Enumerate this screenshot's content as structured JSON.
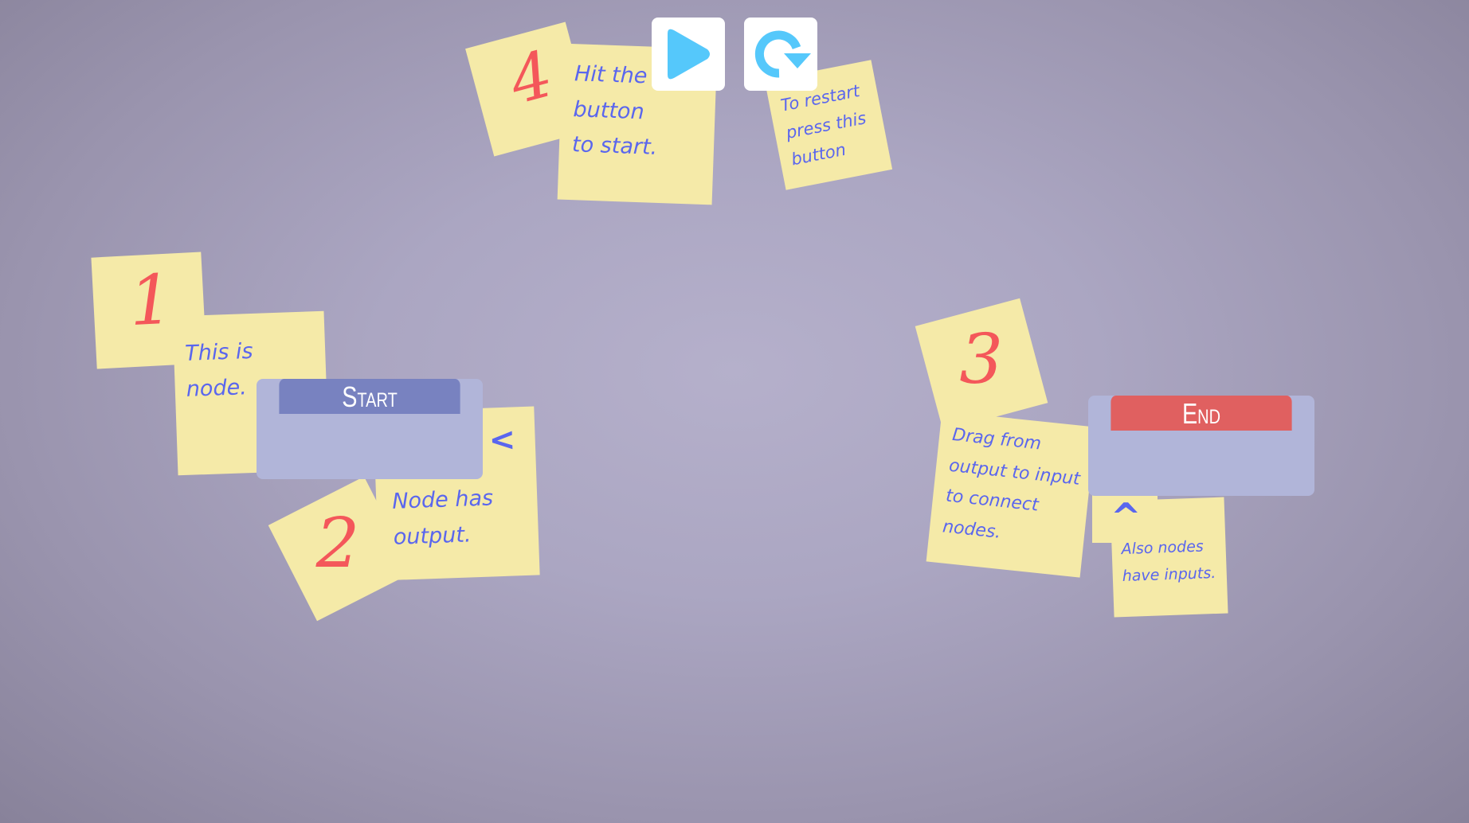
{
  "toolbar": {
    "play_icon": "play-icon",
    "restart_icon": "restart-icon",
    "icon_color": "#55c8fb"
  },
  "notes": {
    "step1": {
      "number": "1",
      "text": "This is node."
    },
    "step2": {
      "number": "2",
      "text": "Node has output."
    },
    "step3": {
      "number": "3",
      "text": "Drag from output to input to connect nodes."
    },
    "step3b": {
      "text": "Also nodes have inputs."
    },
    "step4": {
      "number": "4",
      "text": "Hit the button to start."
    },
    "restart": {
      "text": "To restart press this button"
    }
  },
  "nodes": {
    "start": {
      "title": "Start",
      "color": "#7882c0"
    },
    "end": {
      "title": "End",
      "color": "#e06060"
    }
  },
  "arrows": {
    "output": "<",
    "input": "^"
  }
}
